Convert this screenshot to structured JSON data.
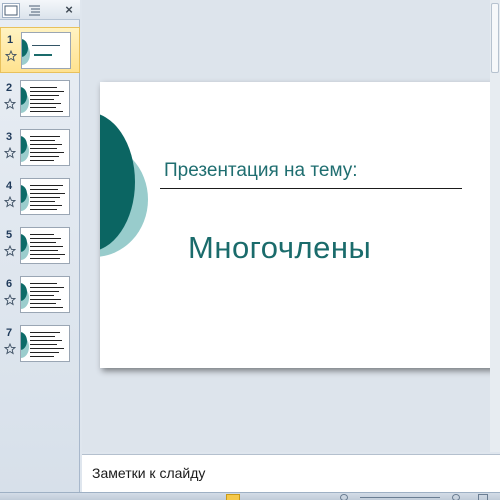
{
  "left_pane": {
    "tabs": [
      {
        "name": "slides-tab-icon"
      },
      {
        "name": "outline-tab-icon"
      }
    ],
    "close_label": "×",
    "thumbnails": [
      {
        "number": "1",
        "selected": true
      },
      {
        "number": "2",
        "selected": false
      },
      {
        "number": "3",
        "selected": false
      },
      {
        "number": "4",
        "selected": false
      },
      {
        "number": "5",
        "selected": false
      },
      {
        "number": "6",
        "selected": false
      },
      {
        "number": "7",
        "selected": false
      }
    ]
  },
  "slide": {
    "subtitle": "Презентация на тему:",
    "title": "Многочлены",
    "colors": {
      "dark_circle": "#0b6562",
      "light_circle": "#98cccc",
      "text": "#1a6b6b"
    }
  },
  "notes": {
    "placeholder": "Заметки к слайду"
  }
}
